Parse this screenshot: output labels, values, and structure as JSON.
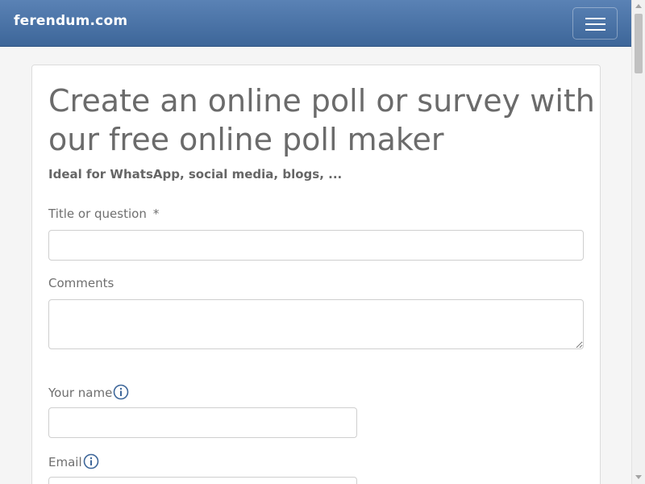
{
  "header": {
    "brand": "ferendum.com",
    "menu_icon": "hamburger-menu-icon"
  },
  "form": {
    "title": "Create an online poll or survey with our free online poll maker",
    "subtitle": "Ideal for WhatsApp, social media, blogs, ...",
    "fields": {
      "title_label": "Title or question",
      "required_mark": "*",
      "title_value": "",
      "comments_label": "Comments",
      "comments_value": "",
      "name_label": "Your name",
      "name_value": "",
      "email_label": "Email",
      "email_value": ""
    },
    "icons": {
      "info": "info-icon"
    }
  },
  "colors": {
    "navbar_top": "#5a82b5",
    "navbar_bottom": "#3d6699",
    "info_icon": "#3d6699"
  }
}
